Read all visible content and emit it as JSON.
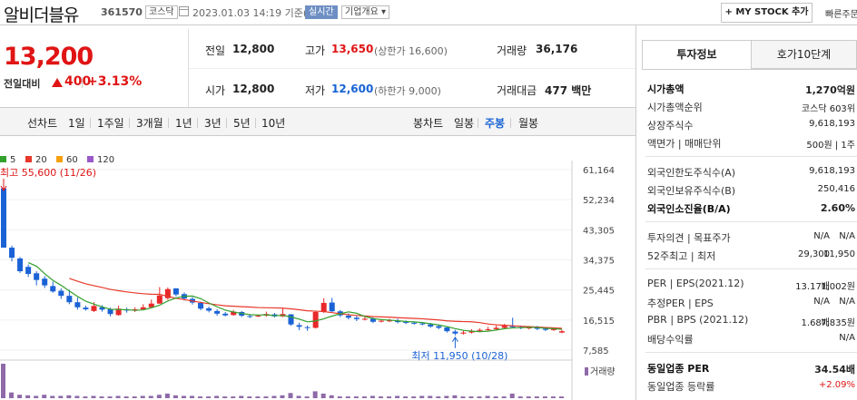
{
  "header": {
    "name": "알비더블유",
    "code": "361570",
    "market": "코스닥",
    "datetime": "2023.01.03 14:19 기준(장중)",
    "realtime": "실시간",
    "company": "기업개요 ▾",
    "mystock": "+ MY STOCK 추가",
    "quick_order": "빠른주문"
  },
  "price": {
    "current": "13,200",
    "vs_label": "전일대비",
    "change": "400",
    "change_pct": "+3.13%",
    "prev_label": "전일",
    "prev": "12,800",
    "high_label": "고가",
    "high": "13,650",
    "upper_limit": "(상한가 16,600)",
    "volume_label": "거래량",
    "volume": "36,176",
    "open_label": "시가",
    "open": "12,800",
    "low_label": "저가",
    "low": "12,600",
    "lower_limit": "(하한가 9,000)",
    "amount_label": "거래대금",
    "amount": "477 백만"
  },
  "tabs": {
    "line_label": "선차트",
    "line": [
      "1일",
      "1주일",
      "3개월",
      "1년",
      "3년",
      "5년",
      "10년"
    ],
    "candle_label": "봉차트",
    "candle": [
      "일봉",
      "주봉",
      "월봉"
    ],
    "active": "주봉"
  },
  "chart_data": {
    "type": "candlestick",
    "legend": [
      {
        "name": "5",
        "color": "#33a02c"
      },
      {
        "name": "20",
        "color": "#e8382a"
      },
      {
        "name": "60",
        "color": "#f5a011"
      },
      {
        "name": "120",
        "color": "#9a58c9"
      }
    ],
    "yticks": [
      "61,164",
      "52,234",
      "43,305",
      "34,375",
      "25,445",
      "16,515",
      "7,585"
    ],
    "ylim": [
      7585,
      61164
    ],
    "max_label": "최고 55,600 (11/26)",
    "min_label": "최저 11,950 (10/28)",
    "volume_label": "거래량",
    "candles": [
      [
        55600,
        38000,
        55600,
        38000
      ],
      [
        38000,
        35000,
        38600,
        33900
      ],
      [
        34800,
        31000,
        35200,
        30500
      ],
      [
        32300,
        30200,
        33000,
        29300
      ],
      [
        30400,
        28400,
        31000,
        26800
      ],
      [
        28800,
        26800,
        29600,
        26000
      ],
      [
        26600,
        25000,
        27900,
        24600
      ],
      [
        25200,
        23700,
        25900,
        22800
      ],
      [
        23700,
        21800,
        25500,
        21200
      ],
      [
        21800,
        20300,
        23200,
        19600
      ],
      [
        20200,
        19700,
        20800,
        19300
      ],
      [
        19200,
        20700,
        21800,
        18900
      ],
      [
        20300,
        19600,
        20900,
        19000
      ],
      [
        19700,
        18300,
        20200,
        17600
      ],
      [
        18000,
        19900,
        20800,
        17800
      ],
      [
        19600,
        19400,
        20200,
        18700
      ],
      [
        19300,
        19700,
        20300,
        18900
      ],
      [
        19700,
        20300,
        21200,
        19600
      ],
      [
        20300,
        21400,
        22600,
        20000
      ],
      [
        21400,
        23800,
        26300,
        21300
      ],
      [
        23000,
        25700,
        26200,
        22500
      ],
      [
        25900,
        24100,
        26000,
        23500
      ],
      [
        24200,
        22900,
        24700,
        22300
      ],
      [
        22800,
        21700,
        23300,
        21100
      ],
      [
        21600,
        19900,
        22000,
        19400
      ],
      [
        20000,
        19300,
        20500,
        18800
      ],
      [
        19200,
        18400,
        19700,
        17800
      ],
      [
        18400,
        17900,
        18900,
        17600
      ],
      [
        18000,
        19000,
        19500,
        17800
      ],
      [
        18900,
        17800,
        19200,
        17400
      ],
      [
        17700,
        17500,
        18100,
        17100
      ],
      [
        17600,
        17800,
        18200,
        17400
      ],
      [
        17800,
        18300,
        19000,
        17500
      ],
      [
        18200,
        17600,
        18600,
        17300
      ],
      [
        17600,
        18300,
        20100,
        17400
      ],
      [
        18200,
        15200,
        18300,
        14800
      ],
      [
        15000,
        14500,
        15700,
        13500
      ],
      [
        14400,
        14300,
        14900,
        13300
      ],
      [
        14200,
        18900,
        19200,
        14000
      ],
      [
        19000,
        21600,
        23000,
        18600
      ],
      [
        21700,
        19100,
        23100,
        18900
      ],
      [
        19100,
        17900,
        19500,
        17400
      ],
      [
        17800,
        17200,
        18500,
        16700
      ],
      [
        17200,
        16800,
        17700,
        16200
      ],
      [
        16800,
        16900,
        17500,
        16400
      ],
      [
        16900,
        16000,
        17300,
        15600
      ],
      [
        16100,
        16300,
        16800,
        15800
      ],
      [
        16300,
        16400,
        16900,
        15900
      ],
      [
        16300,
        15900,
        16900,
        15500
      ],
      [
        15900,
        15700,
        16400,
        15300
      ],
      [
        15700,
        15500,
        16000,
        15100
      ],
      [
        15500,
        15300,
        15800,
        14900
      ],
      [
        15200,
        14600,
        15700,
        14200
      ],
      [
        14700,
        14200,
        15100,
        13800
      ],
      [
        14300,
        13200,
        14600,
        12800
      ],
      [
        13100,
        12500,
        13600,
        11950
      ],
      [
        12500,
        12800,
        13400,
        12200
      ],
      [
        12800,
        13300,
        13800,
        12500
      ],
      [
        13300,
        13600,
        14000,
        12900
      ],
      [
        13600,
        13800,
        14500,
        13300
      ],
      [
        13800,
        14200,
        14900,
        13500
      ],
      [
        14200,
        14800,
        15400,
        13900
      ],
      [
        14800,
        14400,
        17200,
        14200
      ],
      [
        14400,
        14100,
        14900,
        13800
      ],
      [
        14100,
        14300,
        14700,
        13700
      ],
      [
        14300,
        13900,
        14800,
        13500
      ],
      [
        13900,
        13600,
        14300,
        13200
      ],
      [
        13600,
        13800,
        14300,
        13300
      ],
      [
        12800,
        13200,
        13650,
        12600
      ]
    ],
    "volumes": [
      60,
      10,
      6,
      5,
      4,
      6,
      4,
      4,
      5,
      4,
      3,
      4,
      3,
      3,
      4,
      3,
      3,
      4,
      4,
      6,
      8,
      5,
      4,
      4,
      3,
      3,
      4,
      3,
      3,
      4,
      3,
      3,
      3,
      4,
      5,
      9,
      4,
      3,
      12,
      8,
      5,
      3,
      3,
      3,
      3,
      4,
      3,
      3,
      4,
      3,
      3,
      4,
      4,
      3,
      4,
      5,
      3,
      3,
      3,
      4,
      3,
      3,
      8,
      3,
      3,
      3,
      3,
      3,
      3
    ]
  },
  "invest": {
    "tab1": "투자정보",
    "tab2": "호가10단계",
    "rows1": [
      {
        "k": "시가총액",
        "v": "1,270억원",
        "bold": true
      },
      {
        "k": "시가총액순위",
        "v": "코스닥 603위"
      },
      {
        "k": "상장주식수",
        "v": "9,618,193"
      },
      {
        "k": "액면가 | 매매단위",
        "v": "500원 | 1주"
      }
    ],
    "rows2": [
      {
        "k": "외국인한도주식수(A)",
        "v": "9,618,193"
      },
      {
        "k": "외국인보유주식수(B)",
        "v": "250,416"
      },
      {
        "k": "외국인소진율(B/A)",
        "v": "2.60%",
        "bold": true
      }
    ],
    "rows3": [
      {
        "k": "투자의견 | 목표주가",
        "v1": "N/A",
        "v": "N/A"
      },
      {
        "k": "52주최고 | 최저",
        "v1": "29,300",
        "v": "11,950"
      }
    ],
    "rows4": [
      {
        "k": "PER | EPS(2021.12)",
        "v1": "13.17배",
        "v": "1,002원"
      },
      {
        "k": "추정PER | EPS",
        "v1": "N/A",
        "v": "N/A"
      },
      {
        "k": "PBR | BPS (2021.12)",
        "v1": "1.68배",
        "v": "7,835원"
      },
      {
        "k": "배당수익률",
        "v": "N/A"
      }
    ],
    "rows5": [
      {
        "k": "동일업종 PER",
        "v": "34.54배",
        "bold": true
      },
      {
        "k": "동일업종 등락률",
        "v": "+2.09%",
        "up": true
      }
    ]
  }
}
